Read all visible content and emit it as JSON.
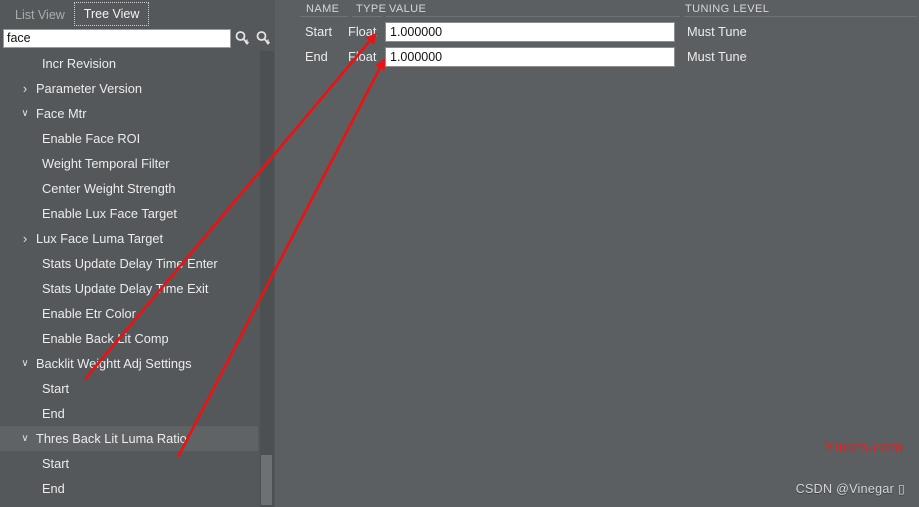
{
  "tabs": [
    {
      "label": "List View",
      "active": false
    },
    {
      "label": "Tree View",
      "active": true
    }
  ],
  "search": {
    "value": "face",
    "placeholder": "",
    "find_prev_icon": "search-down-icon",
    "find_next_icon": "search-down-icon"
  },
  "tree": {
    "items": [
      {
        "label": "Incr Revision",
        "depth": 2,
        "caret": "",
        "selected": false
      },
      {
        "label": "Parameter Version",
        "depth": 1,
        "caret": "›",
        "selected": false
      },
      {
        "label": "Face Mtr",
        "depth": 1,
        "caret": "⌄",
        "selected": false
      },
      {
        "label": "Enable Face ROI",
        "depth": 2,
        "caret": "",
        "selected": false
      },
      {
        "label": "Weight Temporal Filter",
        "depth": 2,
        "caret": "",
        "selected": false
      },
      {
        "label": "Center Weight Strength",
        "depth": 2,
        "caret": "",
        "selected": false
      },
      {
        "label": "Enable Lux Face Target",
        "depth": 2,
        "caret": "",
        "selected": false
      },
      {
        "label": "Lux Face Luma Target",
        "depth": 1,
        "caret": "›",
        "selected": false
      },
      {
        "label": "Stats Update Delay Time Enter",
        "depth": 2,
        "caret": "",
        "selected": false
      },
      {
        "label": "Stats Update Delay Time Exit",
        "depth": 2,
        "caret": "",
        "selected": false
      },
      {
        "label": "Enable Etr Color",
        "depth": 2,
        "caret": "",
        "selected": false
      },
      {
        "label": "Enable Back Lit Comp",
        "depth": 2,
        "caret": "",
        "selected": false
      },
      {
        "label": "Backlit Weightt Adj Settings",
        "depth": 1,
        "caret": "⌄",
        "selected": false
      },
      {
        "label": "Start",
        "depth": 2,
        "caret": "",
        "selected": false
      },
      {
        "label": "End",
        "depth": 2,
        "caret": "",
        "selected": false
      },
      {
        "label": "Thres Back Lit Luma Ratio",
        "depth": 1,
        "caret": "⌄",
        "selected": true
      },
      {
        "label": "Start",
        "depth": 2,
        "caret": "",
        "selected": false
      },
      {
        "label": "End",
        "depth": 2,
        "caret": "",
        "selected": false
      }
    ]
  },
  "grid": {
    "columns": [
      {
        "key": "name",
        "label": "NAME"
      },
      {
        "key": "type",
        "label": "TYPE"
      },
      {
        "key": "value",
        "label": "VALUE"
      },
      {
        "key": "tuning",
        "label": "TUNING LEVEL"
      }
    ],
    "rows": [
      {
        "name": "Start",
        "type": "Float",
        "value": "1.000000",
        "tuning": "Must Tune"
      },
      {
        "name": "End",
        "type": "Float",
        "value": "1.000000",
        "tuning": "Must Tune"
      }
    ]
  },
  "watermarks": {
    "site": "Yuucn.com",
    "author": "CSDN @Vinegar ▯"
  },
  "colors": {
    "panel_bg": "#5b5f61",
    "left_bg": "#55585a",
    "selected_row": "#5f6365",
    "field_bg": "#ffffff",
    "text": "#ececec",
    "header_text": "#d6d6d6",
    "annotation_red": "#ee1111",
    "watermark_red": "#e62020"
  }
}
